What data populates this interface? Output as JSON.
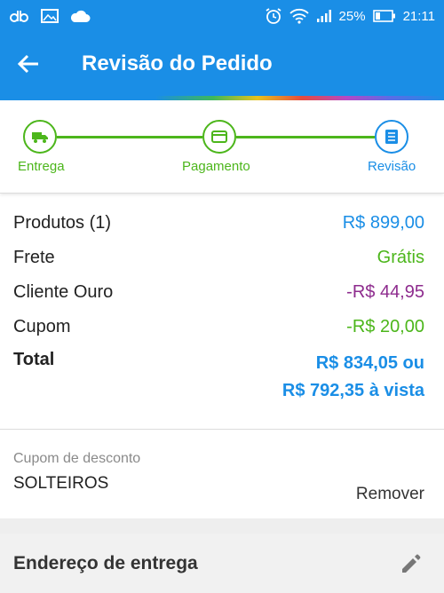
{
  "status_bar": {
    "battery": "25%",
    "time": "21:11"
  },
  "app_bar": {
    "title": "Revisão do Pedido"
  },
  "stepper": {
    "steps": [
      {
        "label": "Entrega",
        "icon": "truck-icon"
      },
      {
        "label": "Pagamento",
        "icon": "credit-card-icon"
      },
      {
        "label": "Revisão",
        "icon": "list-icon"
      }
    ],
    "colors": {
      "done": "#4cb61b",
      "current": "#1a8ee6"
    }
  },
  "summary": {
    "rows": [
      {
        "label": "Produtos (1)",
        "value": "R$ 899,00",
        "color": "#1a8ee6"
      },
      {
        "label": "Frete",
        "value": "Grátis",
        "color": "#4cb61b"
      },
      {
        "label": "Cliente Ouro",
        "value": "-R$ 44,95",
        "color": "#8e2c8e"
      },
      {
        "label": "Cupom",
        "value": "-R$ 20,00",
        "color": "#4cb61b"
      }
    ],
    "total_label": "Total",
    "total_line1": "R$ 834,05 ou",
    "total_line2": "R$ 792,35 à vista"
  },
  "coupon": {
    "label": "Cupom de desconto",
    "code": "SOLTEIROS",
    "remove": "Remover"
  },
  "address": {
    "title": "Endereço de entrega"
  }
}
